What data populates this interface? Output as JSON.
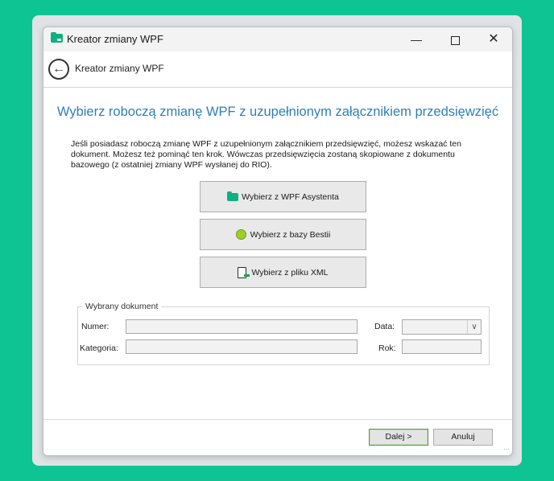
{
  "window": {
    "title": "Kreator zmiany WPF",
    "icons": {
      "app": "wpf-folder-icon",
      "minimize": "minimize-icon",
      "maximize": "maximize-icon",
      "close": "close-icon"
    },
    "controls": {
      "minimize": "—",
      "close": "✕"
    }
  },
  "header": {
    "title": "Kreator zmiany WPF",
    "back_icon": "back-arrow-icon",
    "back_glyph": "←"
  },
  "main": {
    "heading": "Wybierz roboczą zmianę WPF z uzupełnionym załącznikiem przedsięwzięć",
    "description": "Jeśli posiadasz roboczą zmianę WPF z uzupełnionym załącznikiem przedsięwzięć, możesz wskazać ten dokument. Możesz też pominąć ten krok. Wówczas przedsięwzięcia zostaną skopiowane z dokumentu bazowego (z ostatniej zmiany WPF wysłanej do RIO).",
    "buttons": {
      "wpf_asystent": "Wybierz z WPF Asystenta",
      "bestia": "Wybierz z bazy Bestii",
      "xml": "Wybierz z pliku XML"
    }
  },
  "selected_document": {
    "legend": "Wybrany dokument",
    "numer_label": "Numer:",
    "numer_value": "",
    "kategoria_label": "Kategoria:",
    "kategoria_value": "",
    "data_label": "Data:",
    "data_value": "",
    "rok_label": "Rok:",
    "rok_value": ""
  },
  "footer": {
    "next_label": "Dalej >",
    "cancel_label": "Anuluj"
  },
  "colors": {
    "background": "#0fc493",
    "heading": "#2e7fb8",
    "brand_green": "#0fb07f"
  }
}
